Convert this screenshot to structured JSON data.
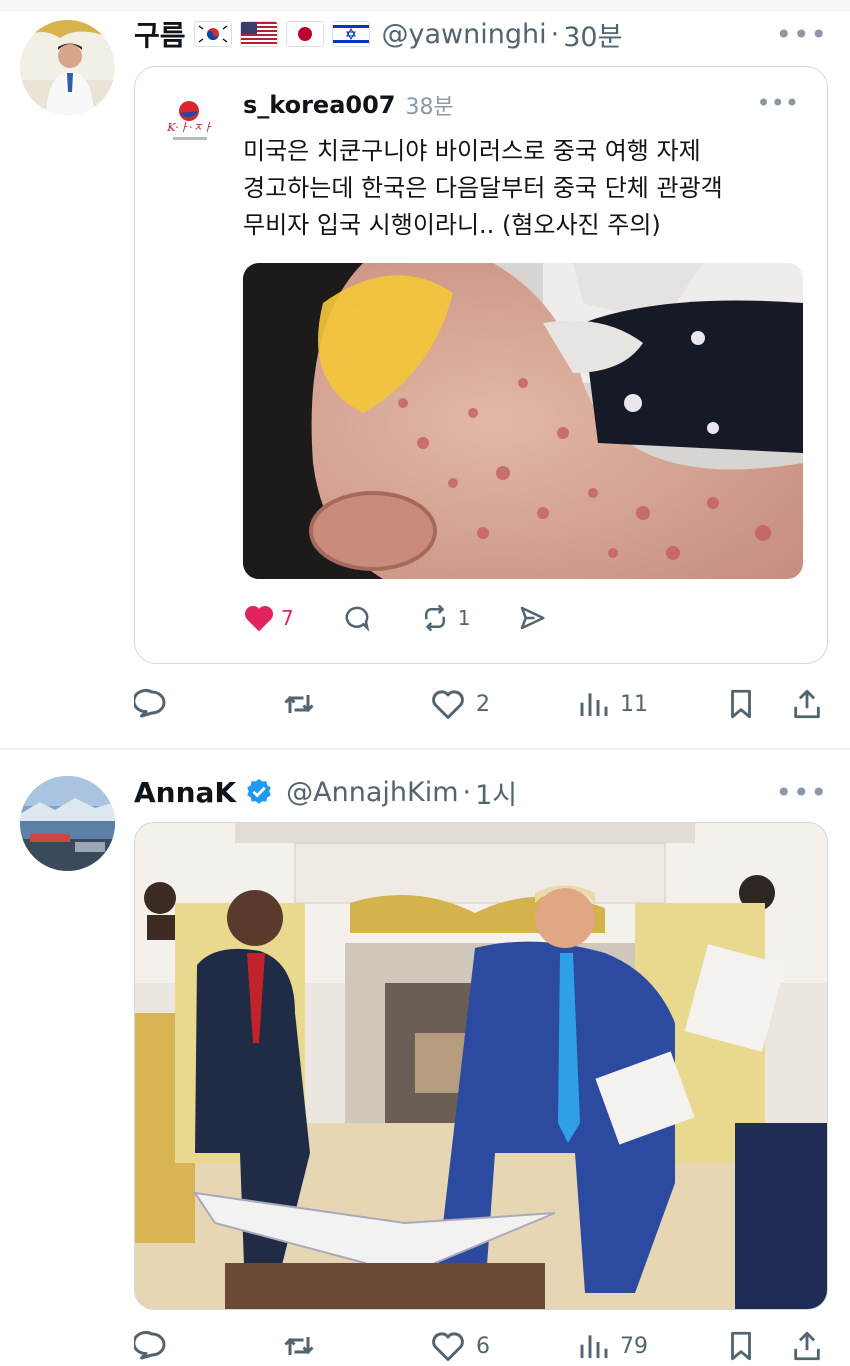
{
  "posts": [
    {
      "author": {
        "name": "구름",
        "handle": "@yawninghi",
        "time": "30분",
        "separator": "·"
      },
      "flags": [
        "kr-flag",
        "us-flag",
        "jp-flag",
        "il-flag"
      ],
      "more_label": "•••",
      "quote": {
        "author_name": "s_korea007",
        "time": "38분",
        "more_label": "•••",
        "text_lines": [
          "미국은 치쿤구니야 바이러스로 중국 여행 자제",
          "경고하는데 한국은 다음달부터 중국 단체 관광객",
          "무비자 입국 시행이라니.. (혐오사진 주의)"
        ],
        "actions": {
          "likes": "7",
          "retweets": "1"
        }
      },
      "actions": {
        "replies": "",
        "retweets": "",
        "likes": "2",
        "views": "11"
      }
    },
    {
      "author": {
        "name": "AnnaK",
        "handle": "@AnnajhKim",
        "time": "1시",
        "separator": "·"
      },
      "more_label": "•••",
      "actions": {
        "replies": "",
        "retweets": "",
        "likes": "6",
        "views": "79"
      }
    }
  ],
  "colors": {
    "text": "#0f1419",
    "muted": "#536471",
    "like_red": "#e0245e",
    "verified_blue": "#1d9bf0",
    "border": "#cfd9de"
  }
}
